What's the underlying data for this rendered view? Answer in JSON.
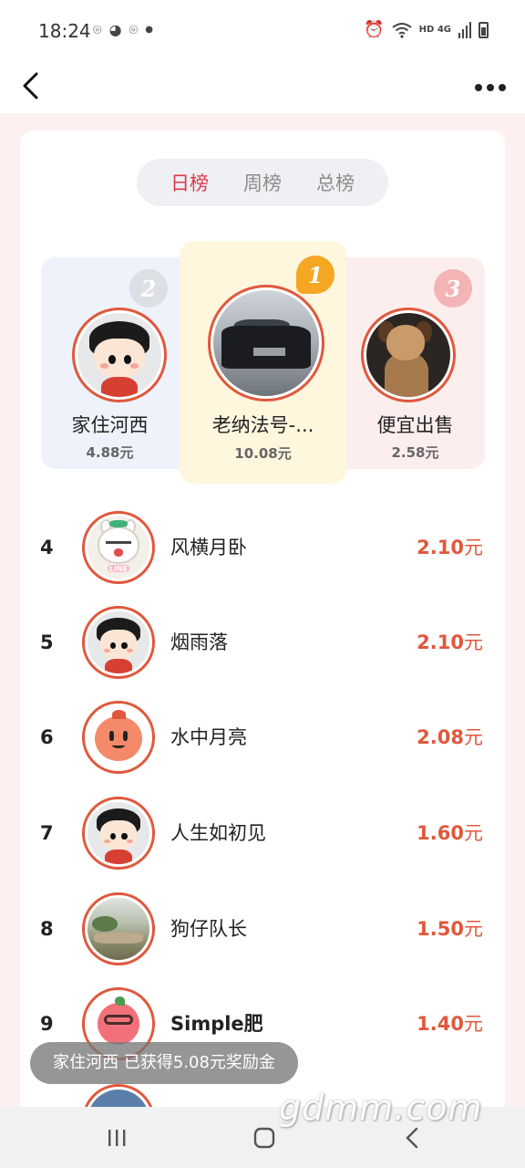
{
  "status_bar": {
    "time": "18:24",
    "network": "HD 4G",
    "left_icons": [
      "location-icon",
      "wechat-icon",
      "location-icon",
      "dot-icon"
    ],
    "right_icons": [
      "alarm-icon",
      "wifi-icon",
      "signal-icon",
      "battery-icon"
    ]
  },
  "nav": {
    "back_icon": "chevron-left-icon",
    "more_icon": "more-dots-icon"
  },
  "tabs": [
    {
      "label": "日榜",
      "active": true
    },
    {
      "label": "周榜",
      "active": false
    },
    {
      "label": "总榜",
      "active": false
    }
  ],
  "podium": [
    {
      "rank": "2",
      "name": "家住河西",
      "amount": "4.88元"
    },
    {
      "rank": "1",
      "name": "老纳法号-...",
      "amount": "10.08元"
    },
    {
      "rank": "3",
      "name": "便宜出售",
      "amount": "2.58元"
    }
  ],
  "ranking": [
    {
      "rank": "4",
      "name": "风横月卧",
      "amount": "2.10",
      "unit": "元"
    },
    {
      "rank": "5",
      "name": "烟雨落",
      "amount": "2.10",
      "unit": "元"
    },
    {
      "rank": "6",
      "name": "水中月亮",
      "amount": "2.08",
      "unit": "元"
    },
    {
      "rank": "7",
      "name": "人生如初见",
      "amount": "1.60",
      "unit": "元"
    },
    {
      "rank": "8",
      "name": "狗仔队长",
      "amount": "1.50",
      "unit": "元"
    },
    {
      "rank": "9",
      "name": "Simple肥",
      "amount": "1.40",
      "unit": "元"
    }
  ],
  "toast": "家住河西   已获得5.08元奖励金",
  "watermark": "gdmm.com",
  "avatar_labels": {
    "line_tag": "LINE"
  },
  "colors": {
    "accent": "#e0384a",
    "amount": "#e0583c",
    "avatar_border": "#e0583c"
  }
}
